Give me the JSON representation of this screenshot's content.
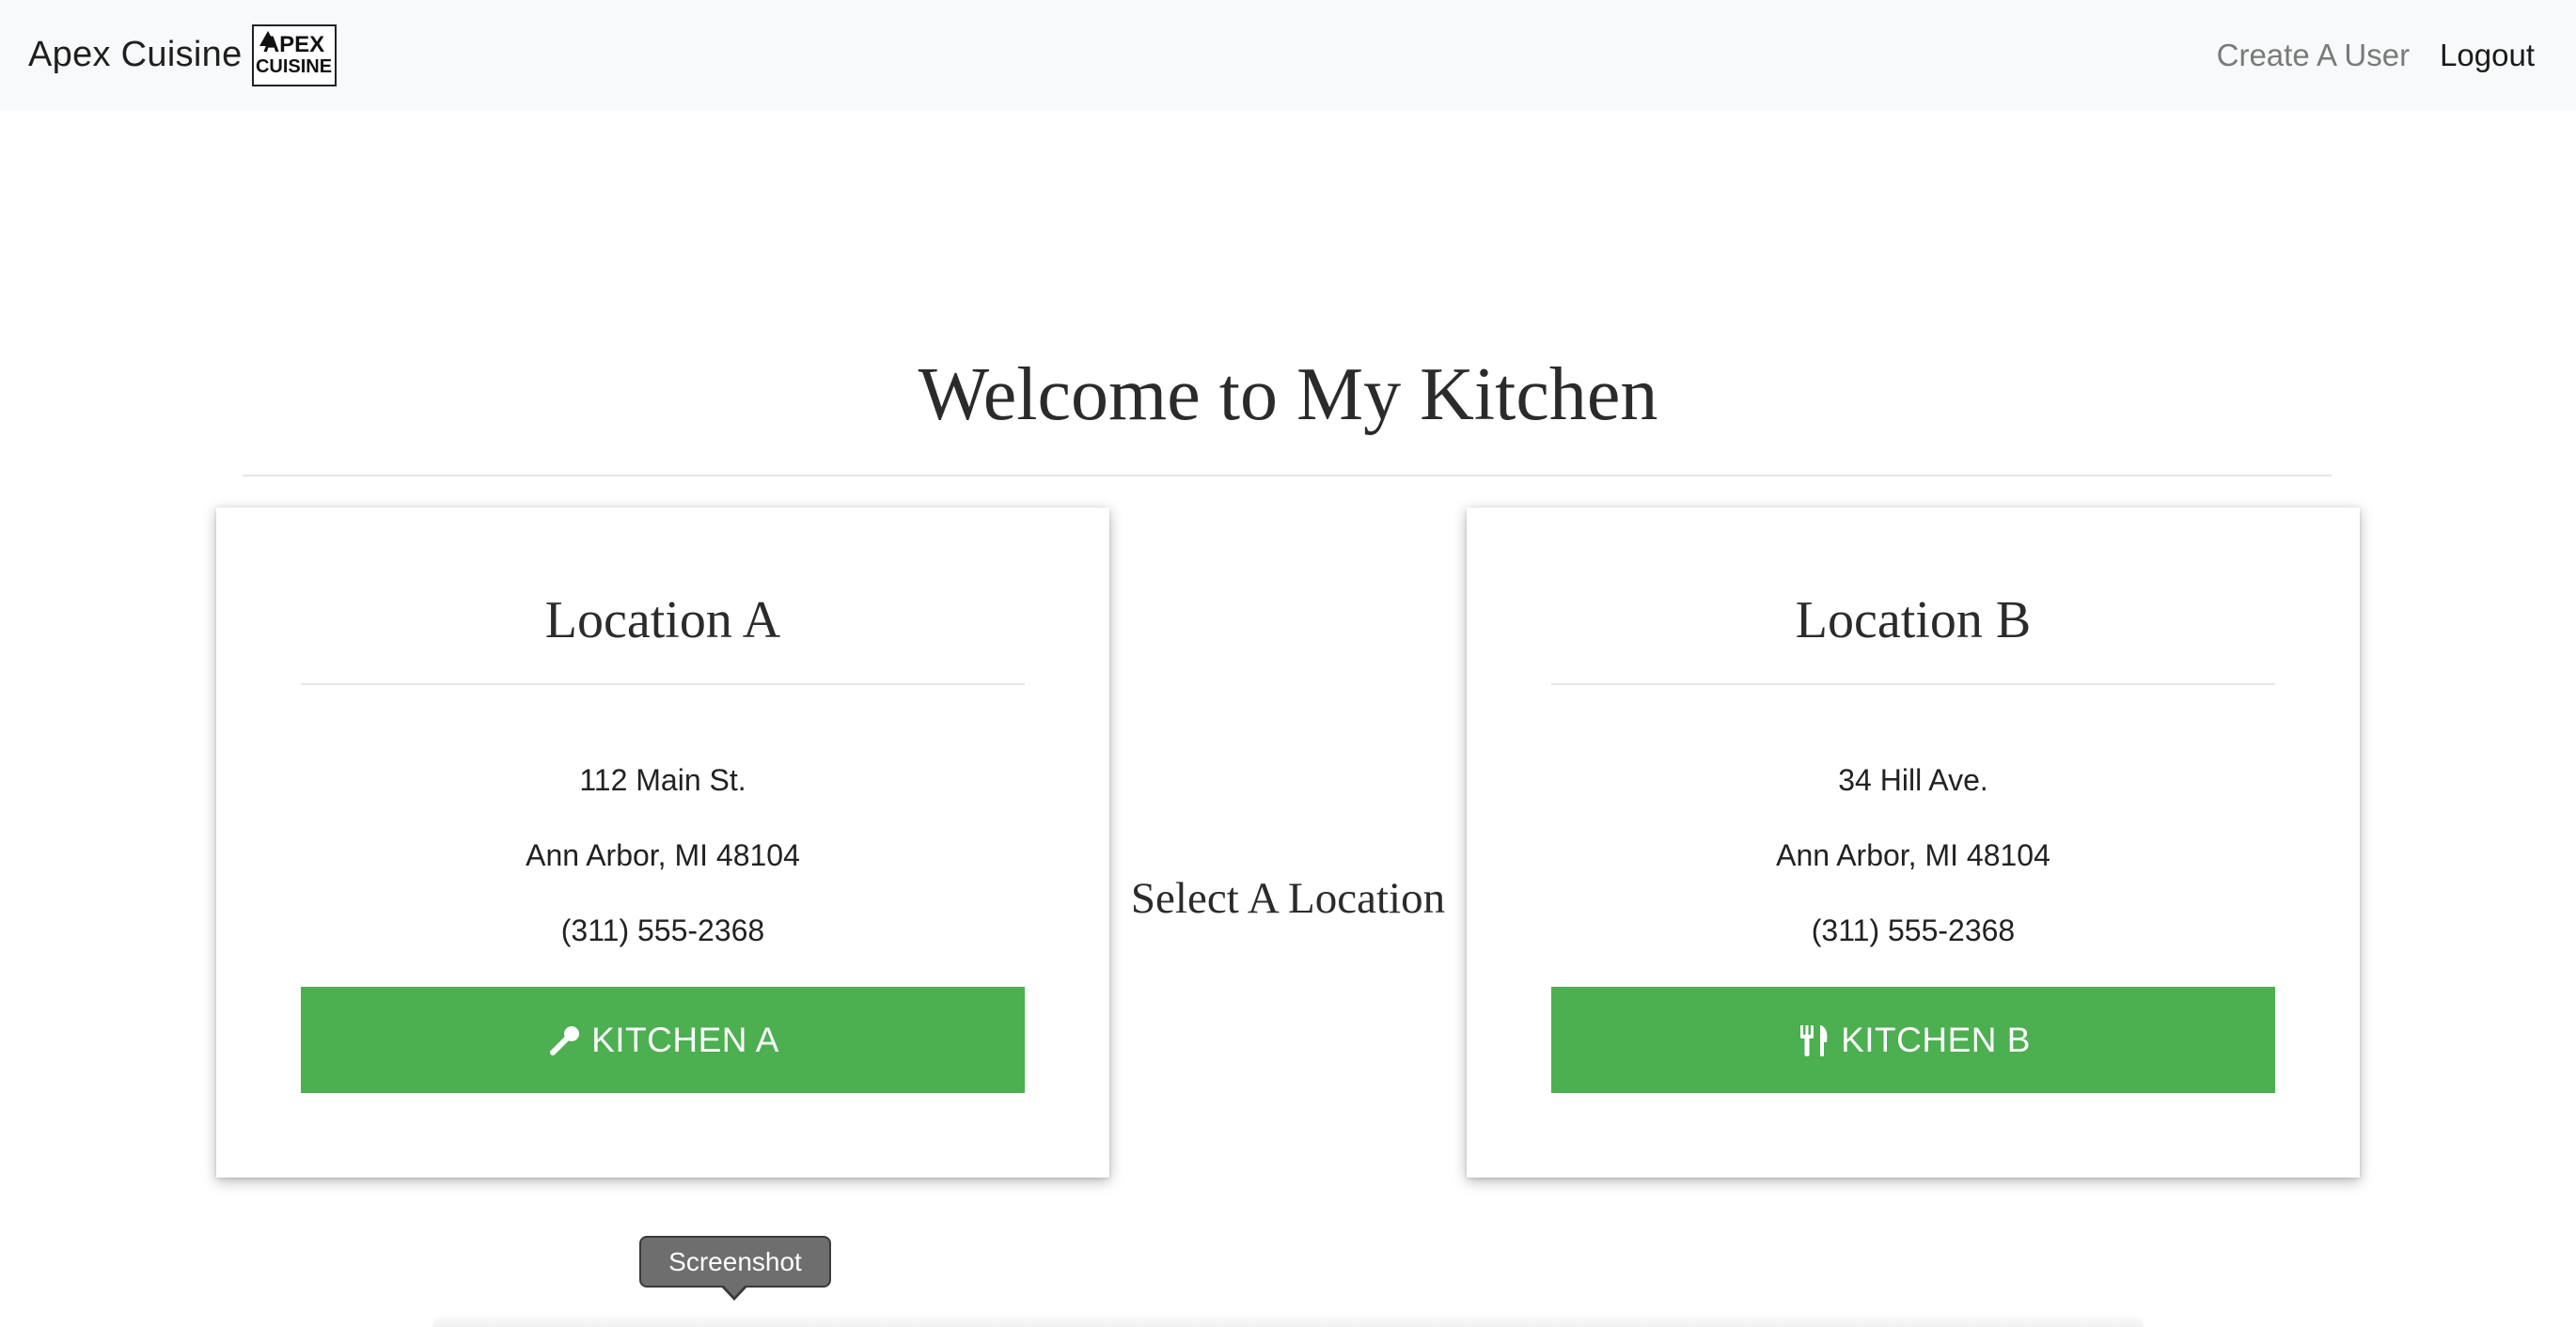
{
  "navbar": {
    "brand_name": "Apex Cuisine",
    "logo_line1": "APEX",
    "logo_line2": "CUISINE",
    "links": {
      "create_user": "Create A User",
      "logout": "Logout"
    }
  },
  "main": {
    "title": "Welcome to My Kitchen",
    "select_text": "Select A Location"
  },
  "locations": [
    {
      "title": "Location A",
      "address1": "112 Main St.",
      "address2": "Ann Arbor, MI 48104",
      "phone": "(311) 555-2368",
      "button_label": "KITCHEN A",
      "button_icon": "spoon-icon"
    },
    {
      "title": "Location B",
      "address1": "34 Hill Ave.",
      "address2": "Ann Arbor, MI 48104",
      "phone": "(311) 555-2368",
      "button_label": "KITCHEN B",
      "button_icon": "utensils-icon"
    }
  ],
  "tooltip": {
    "text": "Screenshot"
  },
  "colors": {
    "button_green": "#4caf50",
    "navbar_bg": "#f8f9fa",
    "muted_link": "#7a7a7a",
    "tooltip_bg": "#6e6e6e"
  }
}
